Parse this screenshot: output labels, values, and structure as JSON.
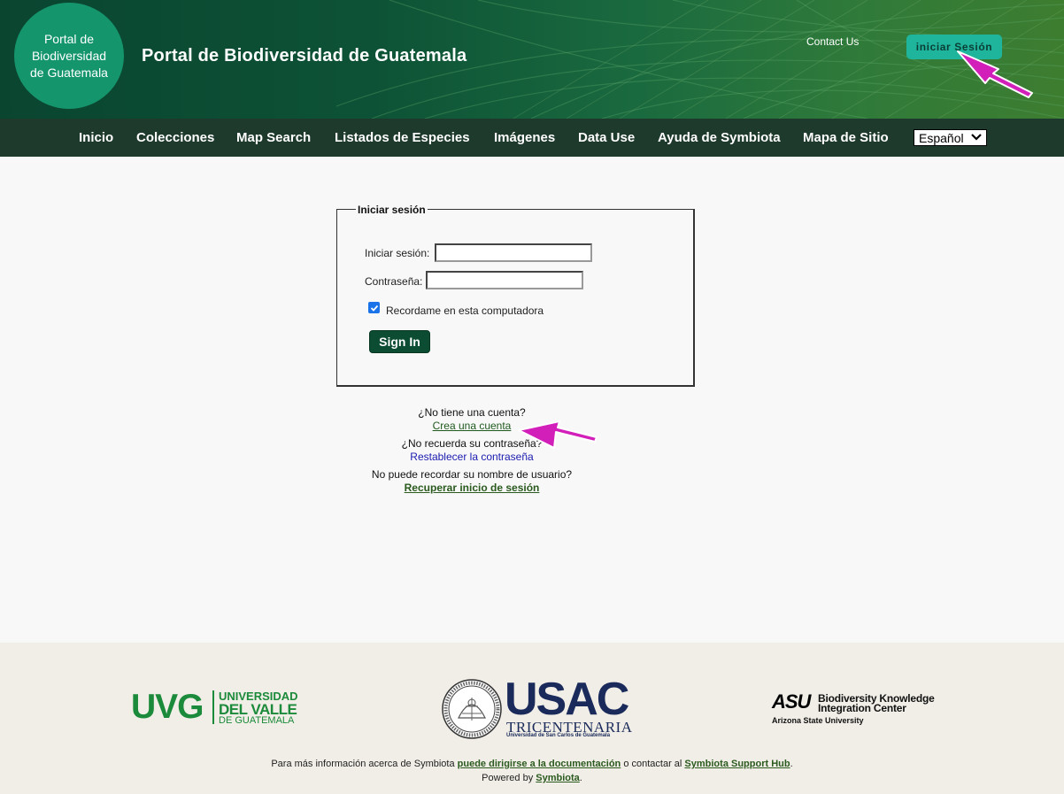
{
  "header": {
    "logo_lines": [
      "Portal de",
      "Biodiversidad",
      "de Guatemala"
    ],
    "site_title": "Portal de Biodiversidad de Guatemala",
    "contact_label": "Contact Us",
    "login_label": "iniciar Sesión"
  },
  "nav": {
    "items": [
      "Inicio",
      "Colecciones",
      "Map Search",
      "Listados de Especies",
      "Imágenes",
      "Data Use",
      "Ayuda de Symbiota",
      "Mapa de Sitio"
    ],
    "language_selected": "Español"
  },
  "login_form": {
    "legend": "Iniciar sesión",
    "username_label": "Iniciar sesión:",
    "username_value": "",
    "password_label": "Contraseña:",
    "password_value": "",
    "remember_label": "Recordame en esta computadora",
    "remember_checked": true,
    "submit_label": "Sign In"
  },
  "help": {
    "no_account_q": "¿No tiene una cuenta?",
    "create_account_link": "Crea una cuenta",
    "forgot_password_q": "¿No recuerda su contraseña?",
    "reset_password_link": "Restablecer la contraseña",
    "forgot_username_q": "No puede recordar su nombre de usuario?",
    "recover_login_link": "Recuperar inicio de sesión"
  },
  "footer": {
    "uvg_abbr": "UVG",
    "uvg_name": [
      "UNIVERSIDAD",
      "DEL VALLE",
      "DE GUATEMALA"
    ],
    "usac_name": "USAC",
    "usac_sub1": "TRICENTENARIA",
    "usac_sub2": "Universidad de San Carlos de Guatemala",
    "asu_mark": "ASU",
    "bkic_name": [
      "Biodiversity Knowledge",
      "Integration Center"
    ],
    "asu_university": "Arizona State University",
    "info_prefix": "Para más información acerca de Symbiota ",
    "info_doc_link": "puede dirigirse a la documentación",
    "info_middle": " o contactar al ",
    "info_hub_link": "Symbiota Support Hub",
    "info_suffix": ".",
    "powered_prefix": "Powered by ",
    "powered_link": "Symbiota",
    "powered_suffix": "."
  },
  "colors": {
    "header_dark": "#0a4530",
    "nav_bg": "#1e3a2c",
    "login_button": "#1fb49c",
    "signin_button": "#0b4c32",
    "annotation_arrow": "#d21fb9",
    "footer_bg": "#f1eee7"
  }
}
